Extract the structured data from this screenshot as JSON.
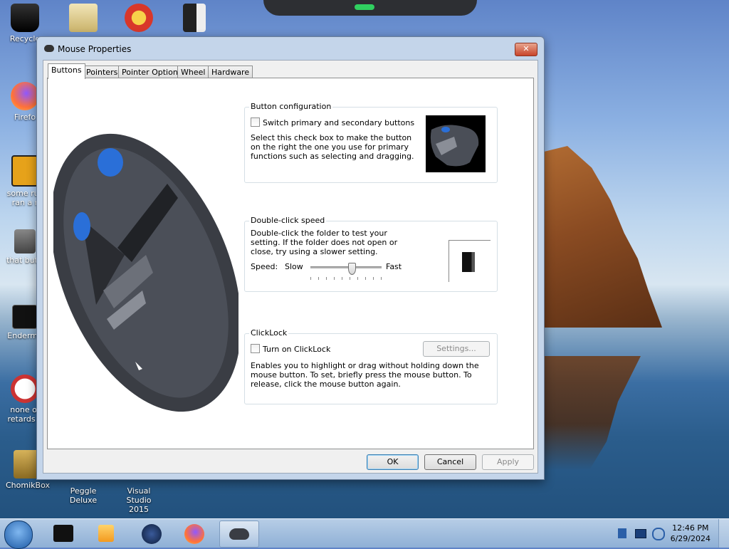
{
  "desktop": {
    "icons": [
      {
        "label": "Recycle",
        "icon": "recycle-bin-icon"
      },
      {
        "label": "Firefo",
        "icon": "firefox-icon"
      },
      {
        "label": "some rus\nran a r",
        "icon": "app-icon"
      },
      {
        "label": "that but r",
        "icon": "folder-icon"
      },
      {
        "label": "Enderma",
        "icon": "terminal-icon"
      },
      {
        "label": "none of\nretards k",
        "icon": "dinosaur-icon"
      },
      {
        "label": "ChomikBox",
        "icon": "chomikbox-icon"
      },
      {
        "label": "Peggle Deluxe",
        "icon": "peggle-icon"
      },
      {
        "label": "Visual Studio\n2015",
        "icon": "visual-studio-icon"
      }
    ]
  },
  "dialog": {
    "title": "Mouse Properties",
    "close_label": "✕",
    "tabs": [
      {
        "label": "Buttons",
        "active": true
      },
      {
        "label": "Pointers",
        "active": false
      },
      {
        "label": "Pointer Options",
        "active": false
      },
      {
        "label": "Wheel",
        "active": false
      },
      {
        "label": "Hardware",
        "active": false
      }
    ],
    "button_config": {
      "title": "Button configuration",
      "checkbox_label": "Switch primary and secondary buttons",
      "description": "Select this check box to make the button on the right the one you use for primary functions such as selecting and dragging."
    },
    "double_click": {
      "title": "Double-click speed",
      "description": "Double-click the folder to test your setting. If the folder does not open or close, try using a slower setting.",
      "speed_label": "Speed:",
      "slow_label": "Slow",
      "fast_label": "Fast",
      "slider_value": 0.58
    },
    "clicklock": {
      "title": "ClickLock",
      "checkbox_label": "Turn on ClickLock",
      "settings_label": "Settings...",
      "description": "Enables you to highlight or drag without holding down the mouse button. To set, briefly press the mouse button. To release, click the mouse button again."
    },
    "buttons": {
      "ok": "OK",
      "cancel": "Cancel",
      "apply": "Apply"
    }
  },
  "taskbar": {
    "items": [
      {
        "icon": "start-orb-icon"
      },
      {
        "icon": "app-icon"
      },
      {
        "icon": "media-player-icon"
      },
      {
        "icon": "app-icon"
      },
      {
        "icon": "firefox-icon"
      },
      {
        "icon": "mouse-icon",
        "active": true
      }
    ],
    "tray_icons": [
      "network-icon",
      "display-icon",
      "flag-icon"
    ],
    "time": "12:46 PM",
    "date": "6/29/2024"
  },
  "colors": {
    "accent": "#3c7fb1",
    "close": "#c8452b"
  }
}
